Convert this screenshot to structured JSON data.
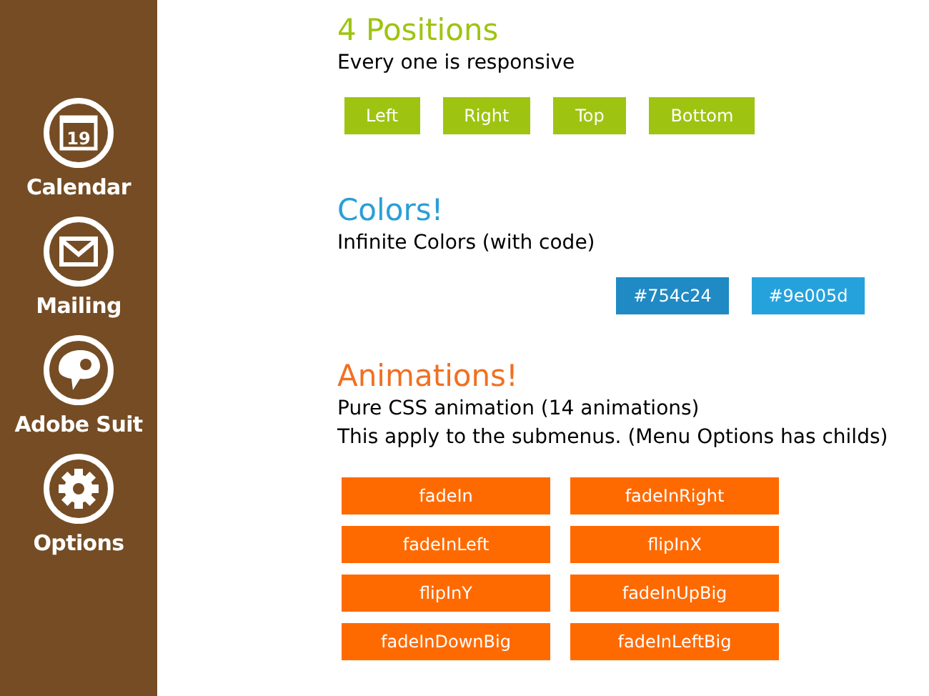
{
  "sidebar": {
    "items": [
      {
        "label": "Calendar",
        "kind": "calendar",
        "day": "19"
      },
      {
        "label": "Mailing",
        "kind": "mail"
      },
      {
        "label": "Adobe Suit",
        "kind": "bubble"
      },
      {
        "label": "Options",
        "kind": "gear"
      }
    ]
  },
  "positions": {
    "title": "4 Positions",
    "subtitle": "Every one is responsive",
    "buttons": [
      "Left",
      "Right",
      "Top",
      "Bottom"
    ]
  },
  "colors": {
    "title": "Colors!",
    "subtitle": "Infinite Colors (with code)",
    "buttons": [
      {
        "label": "#754c24",
        "color": "#1f8ac4"
      },
      {
        "label": "#9e005d",
        "color": "#25a2dc"
      }
    ]
  },
  "animations": {
    "title": "Animations!",
    "lines": [
      "Pure CSS animation (14 animations)",
      "This apply to the submenus. (Menu Options has childs)"
    ],
    "buttons": [
      "fadeIn",
      "fadeInRight",
      "fadeInLeft",
      "flipInX",
      "flipInY",
      "fadeInUpBig",
      "fadeInDownBig",
      "fadeInLeftBig"
    ]
  }
}
